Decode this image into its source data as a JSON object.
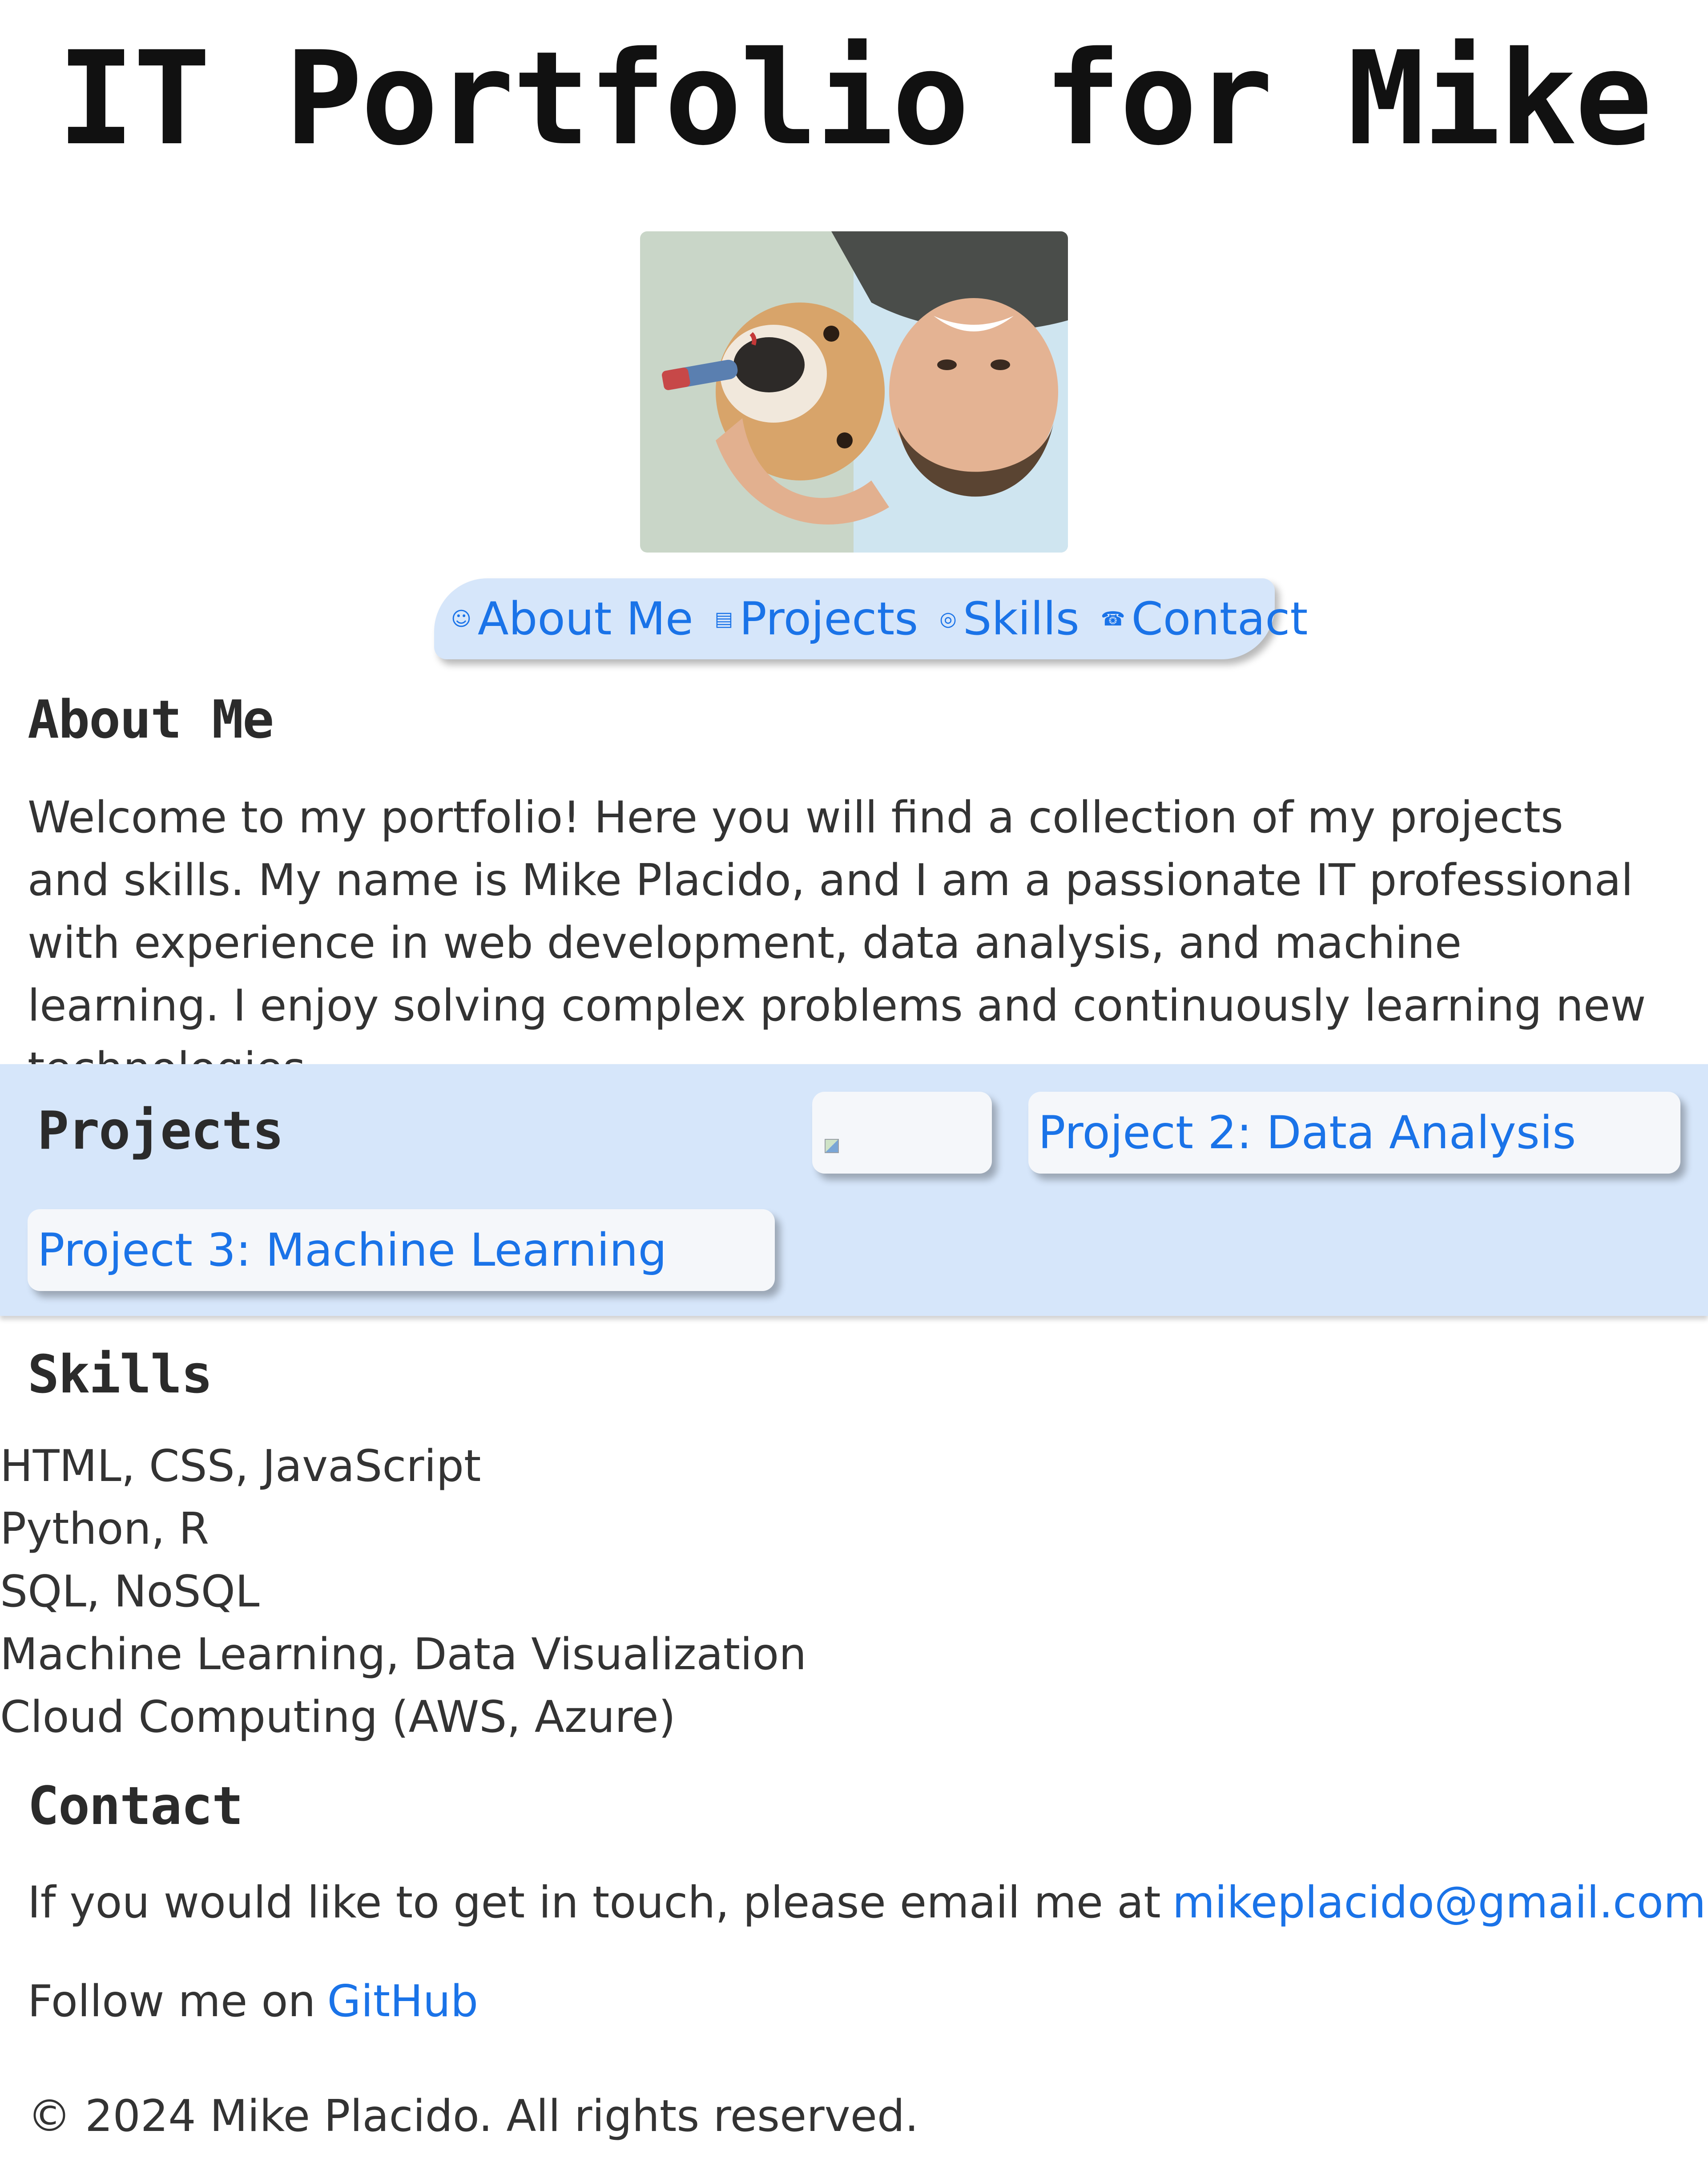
{
  "header": {
    "title": "IT Portfolio for Mike"
  },
  "profile_photo": {
    "alt": "Mike with his dog"
  },
  "nav": {
    "items": [
      {
        "icon": "☺",
        "icon_name": "smiley-icon",
        "label": "About Me"
      },
      {
        "icon": "▤",
        "icon_name": "document-icon",
        "label": "Projects"
      },
      {
        "icon": "◎",
        "icon_name": "target-icon",
        "label": "Skills"
      },
      {
        "icon": "☎",
        "icon_name": "phone-icon",
        "label": "Contact"
      }
    ],
    "accent_color": "#1a73e8",
    "background": "#d6e6fa"
  },
  "about": {
    "heading": "About Me",
    "text": "Welcome to my portfolio! Here you will find a collection of my projects and skills. My name is Mike Placido, and I am a passionate IT professional with experience in web development, data analysis, and machine learning. I enjoy solving complex problems and continuously learning new technologies."
  },
  "projects": {
    "heading": "Projects",
    "items": [
      {
        "label": "",
        "image": "broken-image-icon"
      },
      {
        "label": "Project 2: Data Analysis"
      },
      {
        "label": "Project 3: Machine Learning"
      }
    ]
  },
  "skills": {
    "heading": "Skills",
    "items": [
      "HTML, CSS, JavaScript",
      "Python, R",
      "SQL, NoSQL",
      "Machine Learning, Data Visualization",
      "Cloud Computing (AWS, Azure)"
    ]
  },
  "contact": {
    "heading": "Contact",
    "email_text": "If you would like to get in touch, please email me at",
    "email": "mikeplacido@gmail.com",
    "follow_text": "Follow me on",
    "github_label": "GitHub"
  },
  "footer": {
    "copyright": "© 2024 Mike Placido. All rights reserved."
  }
}
